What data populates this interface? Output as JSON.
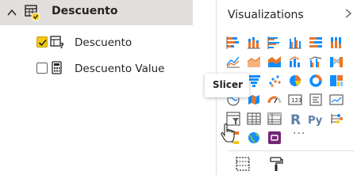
{
  "fields_pane": {
    "table": {
      "name": "Descuento",
      "expanded": true,
      "icon": "table-icon"
    },
    "fields": [
      {
        "label": "Descuento",
        "checked": true,
        "icon": "what-if-parameter-icon"
      },
      {
        "label": "Descuento Value",
        "checked": false,
        "icon": "calculator-measure-icon"
      }
    ]
  },
  "visualizations_pane": {
    "title": "Visualizations",
    "collapse_glyph": ">",
    "more_visuals": "···",
    "icons": [
      "stacked-bar-chart-icon",
      "stacked-column-chart-icon",
      "clustered-bar-chart-icon",
      "clustered-column-chart-icon",
      "100-stacked-bar-chart-icon",
      "100-stacked-column-chart-icon",
      "line-chart-icon",
      "area-chart-icon",
      "stacked-area-chart-icon",
      "line-and-column-chart-icon",
      "line-and-clustered-column-chart-icon",
      "ribbon-chart-icon",
      "waterfall-chart-icon",
      "funnel-chart-icon",
      "scatter-chart-icon",
      "pie-chart-icon",
      "donut-chart-icon",
      "treemap-icon",
      "map-icon",
      "filled-map-icon",
      "gauge-icon",
      "card-icon",
      "multi-row-card-icon",
      "kpi-icon",
      "slicer-icon",
      "table-visual-icon",
      "matrix-icon",
      "r-script-visual-icon",
      "python-visual-icon",
      "key-influencers-icon",
      "decomposition-tree-icon",
      "globe-map-icon",
      "power-apps-icon",
      "fields-well-icon",
      "format-paint-roller-icon"
    ],
    "r_label": "R",
    "py_label": "Py"
  },
  "tooltip": {
    "text": "Slicer"
  },
  "colors": {
    "header_bg": "#e1dfdd",
    "checkbox_checked": "#f2c811",
    "viz_accent": "#e8762c",
    "viz_blue": "#118dff",
    "text": "#252423"
  }
}
